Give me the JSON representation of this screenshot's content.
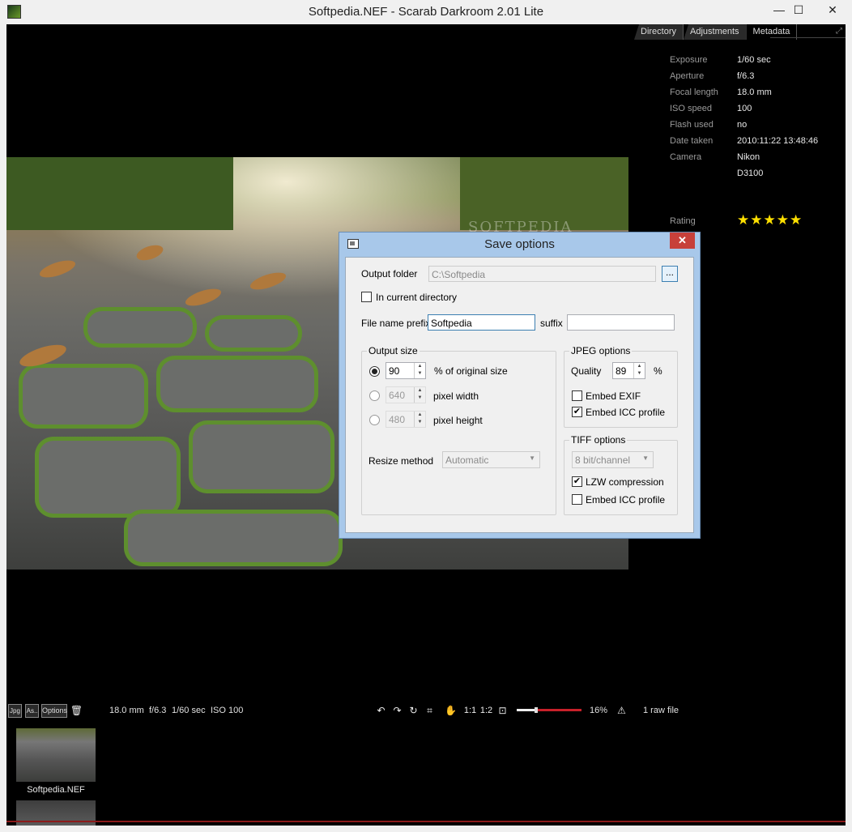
{
  "window": {
    "title": "Softpedia.NEF - Scarab Darkroom 2.01 Lite",
    "min_glyph": "—",
    "max_glyph": "☐",
    "close_glyph": "✕"
  },
  "panel": {
    "tabs": [
      "Directory",
      "Adjustments",
      "Metadata"
    ],
    "expand_glyph": "⤢",
    "metadata": [
      {
        "key": "Exposure",
        "value": "1/60 sec"
      },
      {
        "key": "Aperture",
        "value": "f/6.3"
      },
      {
        "key": "Focal length",
        "value": "18.0 mm"
      },
      {
        "key": "ISO speed",
        "value": "100"
      },
      {
        "key": "Flash used",
        "value": "no"
      },
      {
        "key": "Date taken",
        "value": "2010:11:22 13:48:46"
      },
      {
        "key": "Camera",
        "value": "Nikon"
      },
      {
        "key": "",
        "value": "D3100"
      }
    ],
    "rating_label": "Rating",
    "rating_stars": "★★★★★",
    "rating_value": 5
  },
  "photo": {
    "watermark": "SOFTPEDIA"
  },
  "dialog": {
    "title": "Save options",
    "close_glyph": "✕",
    "output_folder_label": "Output folder",
    "output_folder_value": "C:\\Softpedia",
    "browse_label": "...",
    "in_current_dir_label": "In current directory",
    "in_current_dir_checked": false,
    "prefix_label": "File name prefix",
    "prefix_value": "Softpedia",
    "suffix_label": "suffix",
    "suffix_value": "",
    "output_size": {
      "title": "Output size",
      "percent_value": "90",
      "percent_label": "% of original size",
      "width_value": "640",
      "width_label": "pixel width",
      "height_value": "480",
      "height_label": "pixel height",
      "resize_label": "Resize method",
      "resize_value": "Automatic"
    },
    "jpeg": {
      "title": "JPEG options",
      "quality_label": "Quality",
      "quality_value": "89",
      "quality_unit": "%",
      "embed_exif_label": "Embed EXIF",
      "embed_exif_checked": false,
      "embed_icc_label": "Embed ICC profile",
      "embed_icc_checked": true
    },
    "tiff": {
      "title": "TIFF options",
      "depth_value": "8 bit/channel",
      "lzw_label": "LZW compression",
      "lzw_checked": true,
      "embed_icc_label": "Embed ICC profile",
      "embed_icc_checked": false
    },
    "check_glyph": "✔",
    "spin_up": "▲",
    "spin_down": "▼",
    "combo_arrow": "▼"
  },
  "toolbar": {
    "jpg_label": "Jpg",
    "saveas_label": "As..",
    "options_label": "Options",
    "trash_glyph": "🗑",
    "focal": "18.0 mm",
    "aperture": "f/6.3",
    "shutter": "1/60 sec",
    "iso": "ISO 100",
    "rotate_left": "↶",
    "rotate_right": "↷",
    "reset": "↻",
    "crop": "⌗",
    "hand": "✋",
    "zoom_1_1": "1:1",
    "zoom_1_2": "1:2",
    "fit": "⊡",
    "zoom_level": "16%",
    "zoom_fraction": 0.16,
    "warning_glyph": "⚠",
    "file_count": "1 raw file"
  },
  "filmstrip": {
    "items": [
      {
        "name": "Softpedia.NEF"
      }
    ]
  }
}
